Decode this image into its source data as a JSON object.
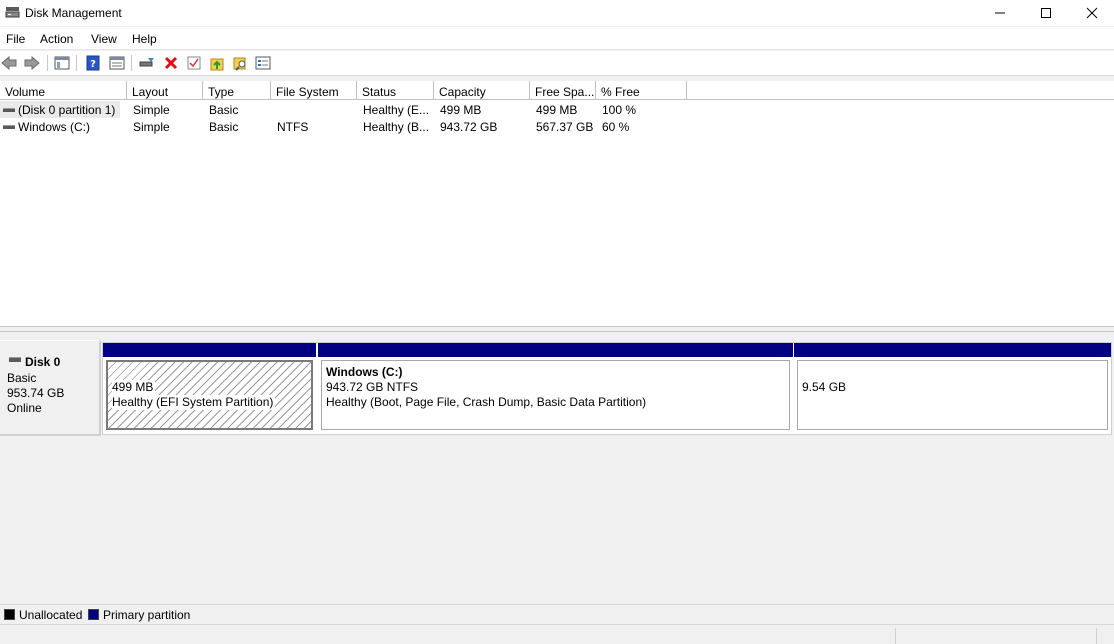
{
  "window": {
    "title": "Disk Management",
    "icons": {
      "app": "disk-management-icon",
      "minimize": "minimize-icon",
      "maximize": "maximize-icon",
      "close": "close-icon"
    }
  },
  "menu": {
    "items": [
      "File",
      "Action",
      "View",
      "Help"
    ]
  },
  "toolbar": {
    "buttons": [
      "back-icon",
      "forward-icon",
      "show-hide-console-tree-icon",
      "help-icon",
      "properties-icon",
      "connect-virtual-disk-icon",
      "delete-icon",
      "check-icon",
      "up-folder-icon",
      "find-icon",
      "settings-icon"
    ]
  },
  "volume_list": {
    "columns": [
      "Volume",
      "Layout",
      "Type",
      "File System",
      "Status",
      "Capacity",
      "Free Spa...",
      "% Free"
    ],
    "rows": [
      {
        "volume": "(Disk 0 partition 1)",
        "layout": "Simple",
        "type": "Basic",
        "file_system": "",
        "status": "Healthy (E...",
        "capacity": "499 MB",
        "free_space": "499 MB",
        "percent_free": "100 %"
      },
      {
        "volume": "Windows (C:)",
        "layout": "Simple",
        "type": "Basic",
        "file_system": "NTFS",
        "status": "Healthy (B...",
        "capacity": "943.72 GB",
        "free_space": "567.37 GB",
        "percent_free": "60 %"
      }
    ]
  },
  "disk": {
    "name": "Disk 0",
    "type": "Basic",
    "size": "953.74 GB",
    "state": "Online",
    "partitions": [
      {
        "name": "",
        "size": "499 MB",
        "status": "Healthy (EFI System Partition)",
        "kind": "primary"
      },
      {
        "name": "Windows  (C:)",
        "size": "943.72 GB NTFS",
        "status": "Healthy (Boot, Page File, Crash Dump, Basic Data Partition)",
        "kind": "primary"
      },
      {
        "name": "",
        "size": "9.54 GB",
        "status": "",
        "kind": "primary"
      }
    ]
  },
  "legend": {
    "items": [
      {
        "label": "Unallocated",
        "color": "#000000"
      },
      {
        "label": "Primary partition",
        "color": "#000080"
      }
    ]
  },
  "colors": {
    "primary_partition": "#000080",
    "unallocated": "#000000"
  }
}
